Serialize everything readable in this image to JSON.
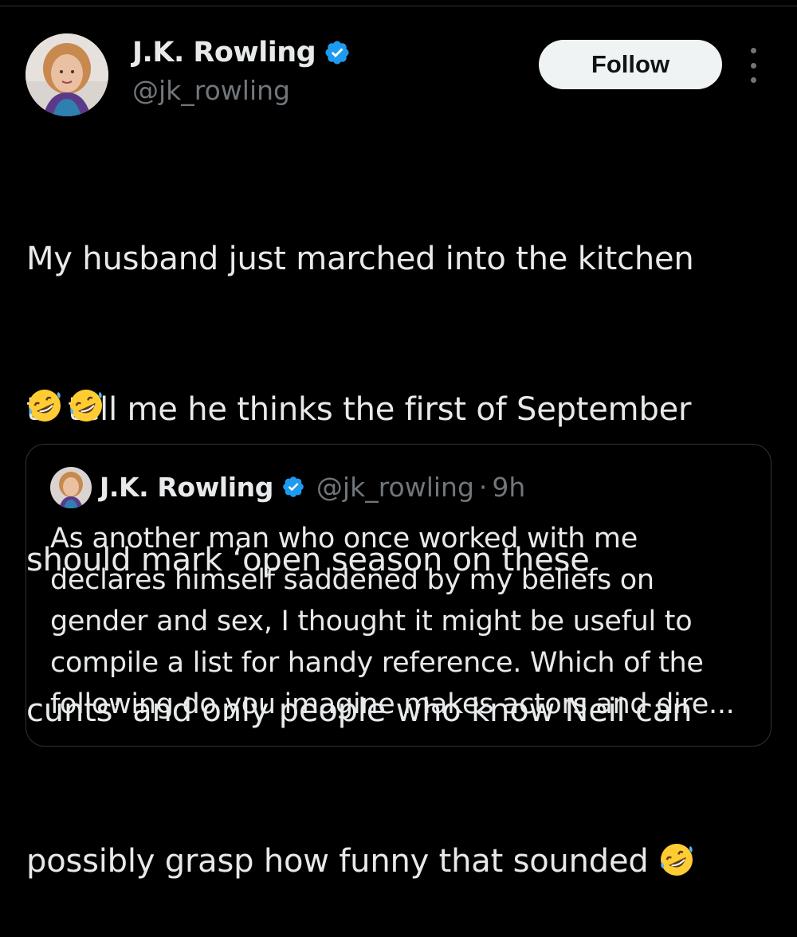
{
  "author": {
    "display_name": "J.K. Rowling",
    "handle": "@jk_rowling",
    "verified_icon": "verified-badge-icon",
    "accent_color": "#1d9bf0"
  },
  "actions": {
    "follow_label": "Follow",
    "more_icon": "more-options-icon"
  },
  "tweet": {
    "line_1": "My husband just marched into the kitchen",
    "line_2": "to tell me he thinks the first of September",
    "line_3": "should mark ‘open season on these",
    "line_4": "cunts’ and only people who know Neil can",
    "line_5": "possibly grasp how funny that sounded",
    "emoji": "🤣"
  },
  "quoted_tweet": {
    "display_name": "J.K. Rowling",
    "handle": "@jk_rowling",
    "separator": "·",
    "time": "9h",
    "line_1": "As another man who once worked with me",
    "line_2": "declares himself saddened by my beliefs on",
    "line_3": "gender and sex, I thought it might be useful to",
    "line_4": "compile a list for handy reference. Which of the",
    "line_5": "following do you imagine makes actors and dire..."
  },
  "colors": {
    "background": "#000000",
    "text_primary": "#e7e9ea",
    "text_secondary": "#71767b",
    "border": "#2f3336",
    "follow_bg": "#eff3f4"
  }
}
